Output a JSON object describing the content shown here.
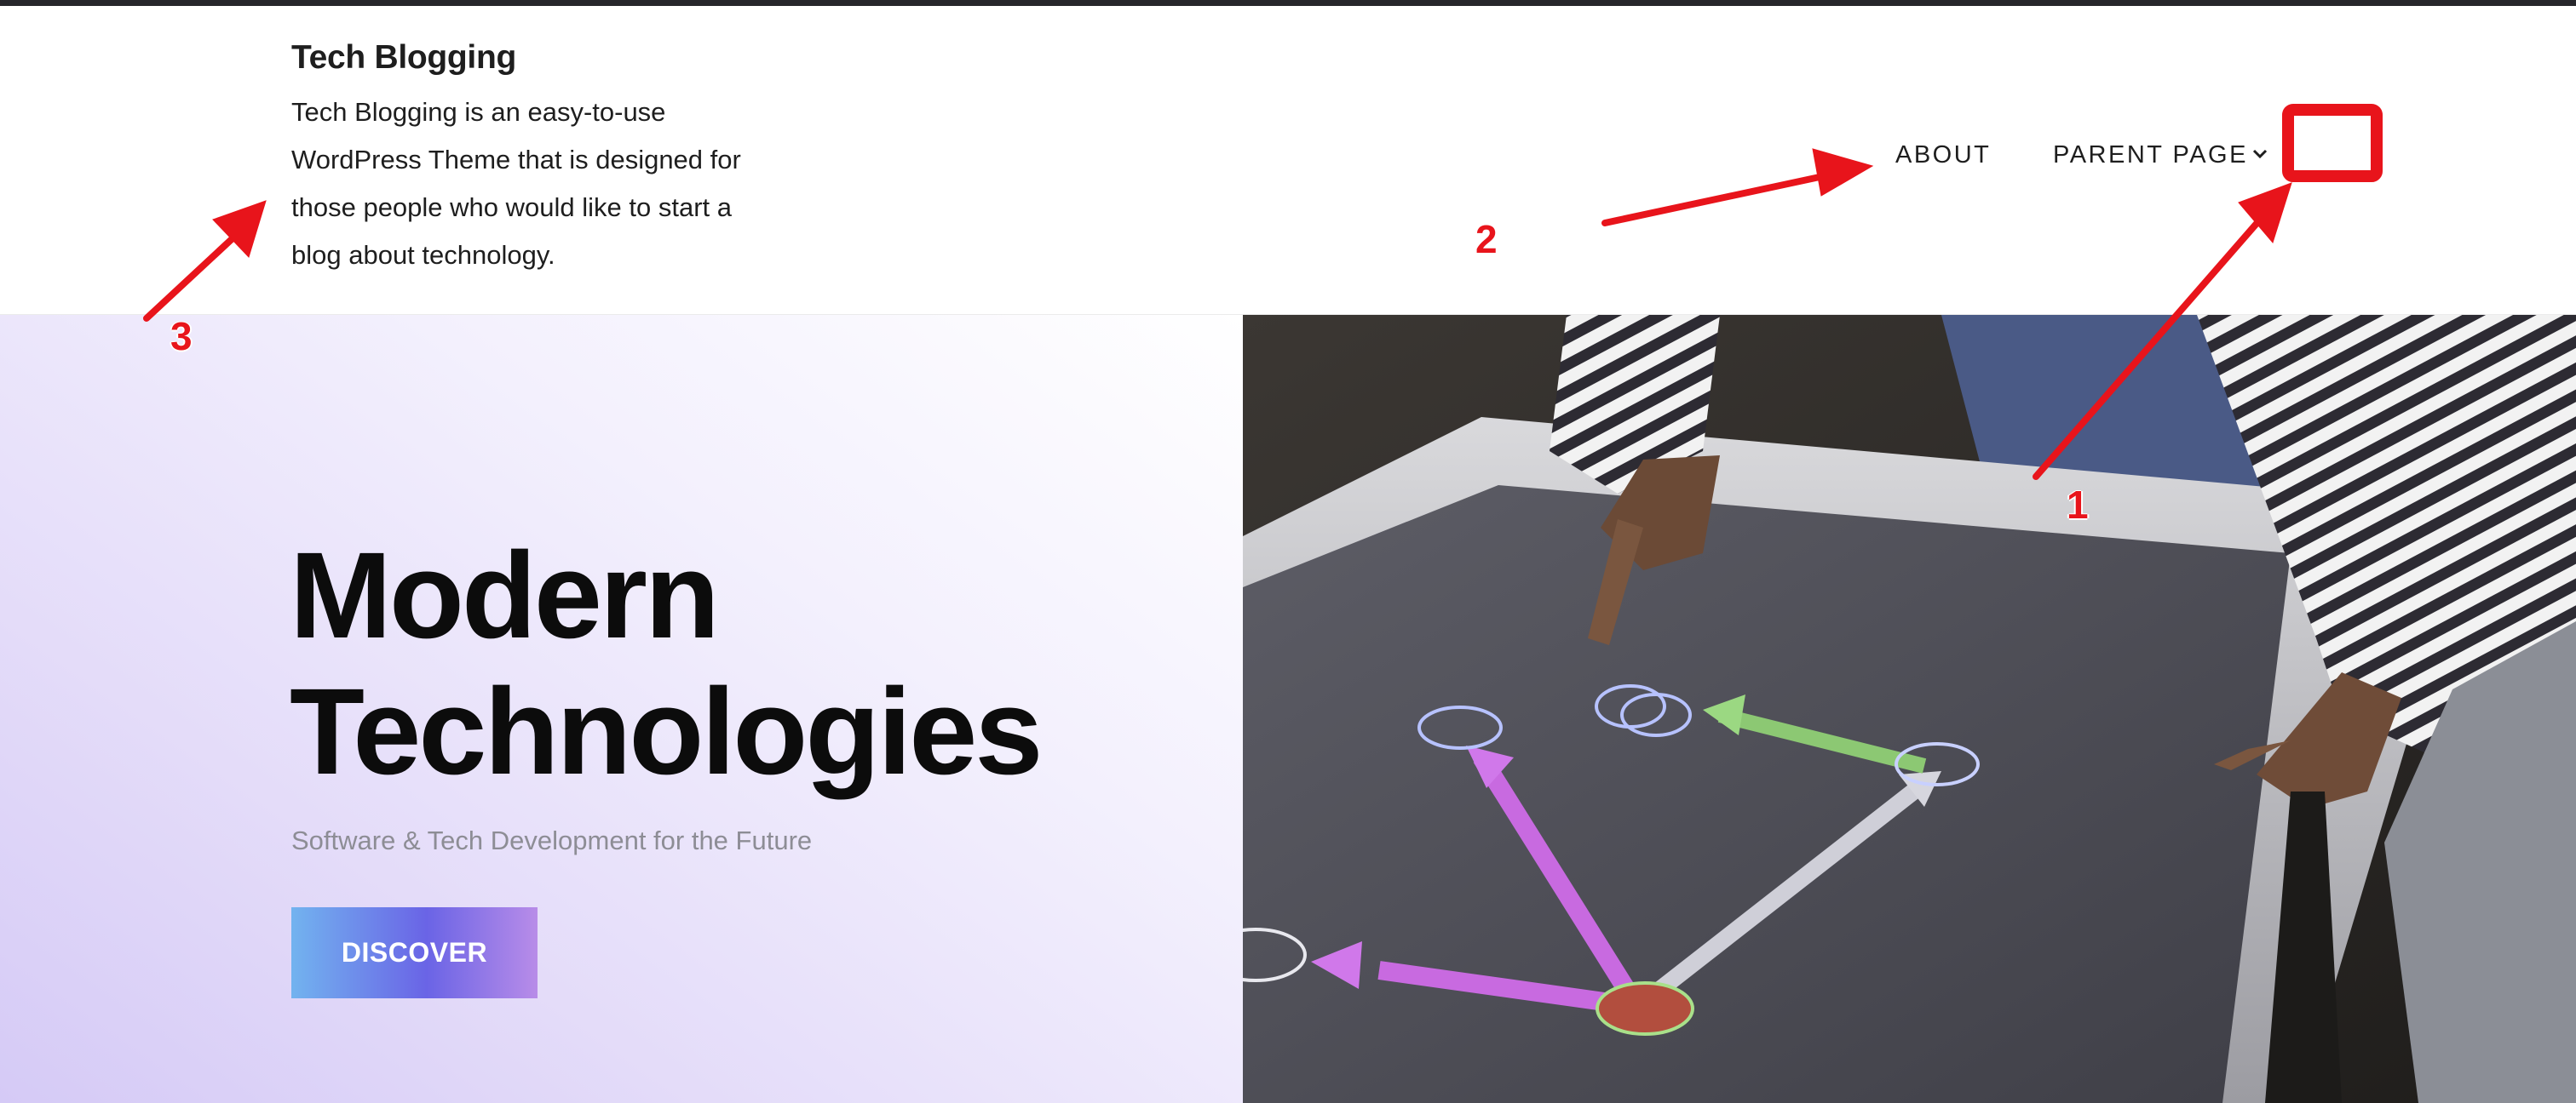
{
  "header": {
    "site_title": "Tech Blogging",
    "site_description": "Tech Blogging is an easy-to-use WordPress Theme that is designed for those people who would like to start a blog about technology.",
    "nav": [
      {
        "label": "ABOUT",
        "has_dropdown": false
      },
      {
        "label": "PARENT PAGE",
        "has_dropdown": true
      }
    ],
    "dropdown_icon": "chevron-down-icon"
  },
  "hero": {
    "title_line1": "Modern",
    "title_line2": "Technologies",
    "subtitle": "Software & Tech Development for the Future",
    "button_label": "DISCOVER",
    "image_subject": "hands interacting with a touchscreen table"
  },
  "annotations": {
    "labels": [
      "1",
      "2",
      "3"
    ],
    "color": "#e8141b"
  },
  "colors": {
    "title_text": "#0c0c0c",
    "subtitle_text": "#8d8d95",
    "button_gradient_start": "#72b3ef",
    "button_gradient_mid": "#6a64e6",
    "button_gradient_end": "#b88ce8",
    "top_bar": "#26262b"
  }
}
